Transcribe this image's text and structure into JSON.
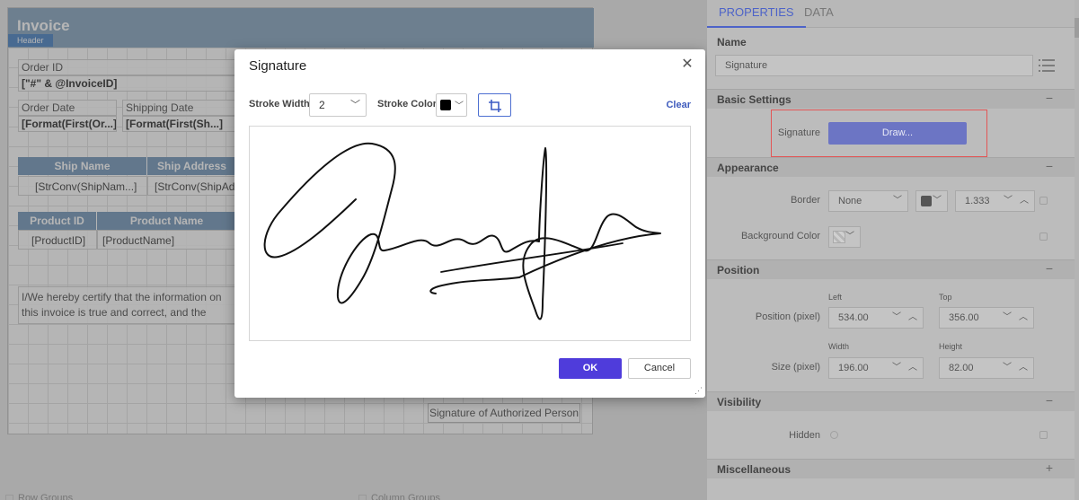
{
  "report": {
    "title": "Invoice",
    "header_tag": "Header",
    "order_id_label": "Order ID",
    "order_id_value": "[\"#\" & @InvoiceID]",
    "order_date_label": "Order Date",
    "order_date_value": "[Format(First(Or...]",
    "shipping_date_label": "Shipping Date",
    "shipping_date_value": "[Format(First(Sh...]",
    "ship_table": {
      "headers": [
        "Ship Name",
        "Ship Address"
      ],
      "cells": [
        "[StrConv(ShipNam...]",
        "[StrConv(ShipAdd"
      ]
    },
    "product_table": {
      "headers": [
        "Product ID",
        "Product Name"
      ],
      "cells": [
        "[ProductID]",
        "[ProductName]"
      ]
    },
    "certify_text": "I/We hereby certify that the information on this invoice is true and correct, and the contents of this shipment are as stated above.",
    "signature_caption": "Signature of Authorized Person",
    "bottom": {
      "row_groups": "Row Groups",
      "column_groups": "Column Groups"
    }
  },
  "dialog": {
    "title": "Signature",
    "close_icon": "close-icon",
    "stroke_width_label": "Stroke Width",
    "stroke_width_value": "2",
    "stroke_color_label": "Stroke Color",
    "stroke_color": "#000000",
    "crop_icon": "crop-icon",
    "clear_label": "Clear",
    "ok_label": "OK",
    "cancel_label": "Cancel"
  },
  "properties": {
    "tabs": [
      "PROPERTIES",
      "DATA"
    ],
    "active_tab": "PROPERTIES",
    "name_label": "Name",
    "name_value": "Signature",
    "sections": {
      "basic": "Basic Settings",
      "appearance": "Appearance",
      "position": "Position",
      "visibility": "Visibility",
      "misc": "Miscellaneous"
    },
    "signature_label": "Signature",
    "draw_label": "Draw...",
    "border_label": "Border",
    "border_value": "None",
    "border_width": "1.333",
    "background_color_label": "Background Color",
    "position_label": "Position (pixel)",
    "left_label": "Left",
    "left_value": "534.00",
    "top_label": "Top",
    "top_value": "356.00",
    "size_label": "Size (pixel)",
    "width_label": "Width",
    "width_value": "196.00",
    "height_label": "Height",
    "height_value": "82.00",
    "hidden_label": "Hidden",
    "accent_color": "#4d63c8",
    "draw_button_color": "#6c75c4",
    "ok_button_color": "#4f3cdb"
  }
}
